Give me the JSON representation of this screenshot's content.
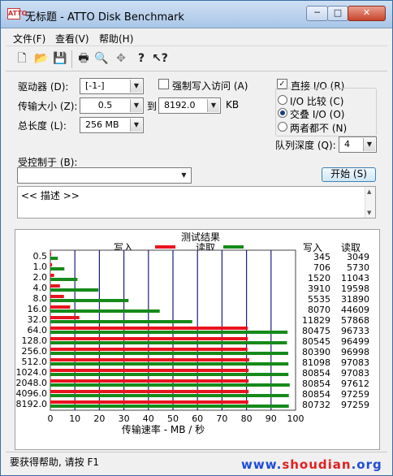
{
  "window": {
    "title": "无标题 - ATTO Disk Benchmark",
    "icon_label": "ATTO",
    "minimize_icon": "minimize-icon",
    "maximize_icon": "maximize-icon",
    "close_icon": "close-icon"
  },
  "menu": [
    {
      "label": "文件(F)"
    },
    {
      "label": "查看(V)"
    },
    {
      "label": "帮助(H)"
    }
  ],
  "toolbar": [
    {
      "icon": "new-file-icon",
      "glyph": "🗋"
    },
    {
      "icon": "open-folder-icon",
      "glyph": "📂"
    },
    {
      "icon": "save-icon",
      "glyph": "💾"
    },
    {
      "icon": "print-icon",
      "glyph": "🖶"
    },
    {
      "icon": "print-preview-icon",
      "glyph": "🔍"
    },
    {
      "icon": "move-icon",
      "glyph": "✥"
    },
    {
      "icon": "help-icon",
      "glyph": "?"
    },
    {
      "icon": "context-help-icon",
      "glyph": "↖?"
    }
  ],
  "settings": {
    "drive_label": "驱动器 (D):",
    "drive_value": "[-1-]",
    "force_write_label": "强制写入访问 (A)",
    "force_write_checked": false,
    "transfer_label": "传输大小 (Z):",
    "transfer_from": "0.5",
    "to_label": "到",
    "transfer_to": "8192.0",
    "unit_label": "KB",
    "total_length_label": "总长度 (L):",
    "total_length_value": "256 MB",
    "direct_io_label": "直接 I/O (R)",
    "direct_io_checked": true,
    "io_compare_label": "I/O 比较 (C)",
    "overlap_io_label": "交叠 I/O (O)",
    "neither_label": "两者都不 (N)",
    "selected_mode": "overlap",
    "queue_depth_label": "队列深度 (Q):",
    "queue_depth_value": "4",
    "controlled_by_label": "受控制于 (B):",
    "controlled_by_value": "",
    "start_button": "开始 (S)",
    "description": "<< 描述 >>"
  },
  "colors": {
    "write": "#e8141e",
    "read": "#168a1a",
    "bar_bg": "#ffffff",
    "grid": "#1c1c80"
  },
  "chart_data": {
    "type": "bar",
    "title": "测试结果",
    "legend": [
      {
        "name": "写入",
        "color": "#e8141e"
      },
      {
        "name": "读取",
        "color": "#168a1a"
      }
    ],
    "column_headers": [
      "写入",
      "读取"
    ],
    "categories": [
      "0.5",
      "1.0",
      "2.0",
      "4.0",
      "8.0",
      "16.0",
      "32.0",
      "64.0",
      "128.0",
      "256.0",
      "512.0",
      "1024.0",
      "2048.0",
      "4096.0",
      "8192.0"
    ],
    "series": [
      {
        "name": "写入",
        "values": [
          345,
          706,
          1520,
          3910,
          5535,
          8070,
          11829,
          80475,
          80545,
          80390,
          81098,
          80854,
          80854,
          80854,
          80732
        ]
      },
      {
        "name": "读取",
        "values": [
          3049,
          5730,
          11043,
          19598,
          31890,
          44609,
          57868,
          96733,
          96499,
          96998,
          97083,
          97083,
          97612,
          97259,
          97259
        ]
      }
    ],
    "xlabel": "传输速率 - MB / 秒",
    "xticks": [
      0,
      10,
      20,
      30,
      40,
      50,
      60,
      70,
      80,
      90,
      100
    ],
    "xlim": [
      0,
      100
    ],
    "value_unit_divisor": 1000
  },
  "status": {
    "text": "要获得帮助, 请按 F1"
  },
  "watermark": {
    "prefix": "www.",
    "middle": "shoudian",
    "suffix": ".org"
  }
}
